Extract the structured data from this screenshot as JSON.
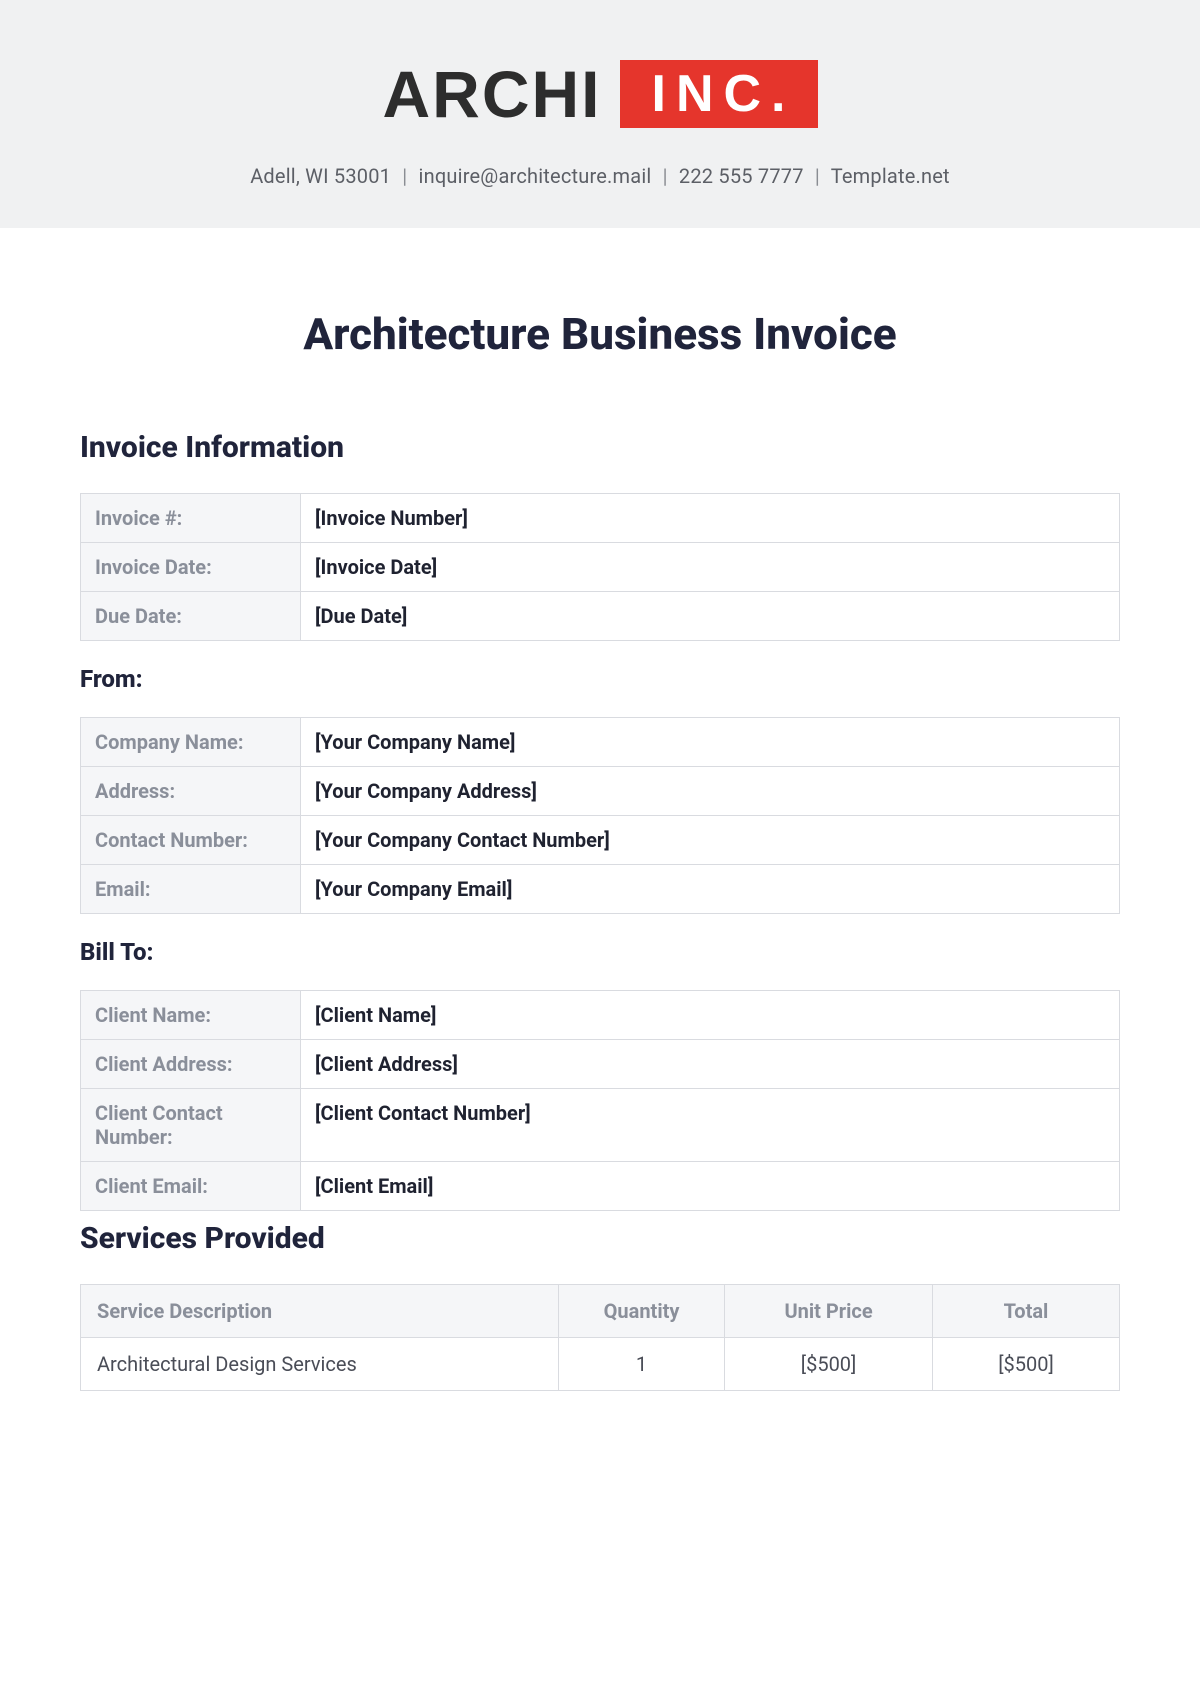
{
  "header": {
    "logo_archi": "ARCHI",
    "logo_inc": "INC.",
    "address": "Adell, WI 53001",
    "email": "inquire@architecture.mail",
    "phone": "222 555 7777",
    "site": "Template.net"
  },
  "title": "Architecture Business Invoice",
  "sections": {
    "invoice_info": "Invoice Information",
    "from": "From:",
    "bill_to": "Bill To:",
    "services": "Services Provided"
  },
  "invoice_info": {
    "rows": [
      {
        "label": "Invoice #:",
        "value": "[Invoice Number]"
      },
      {
        "label": "Invoice Date:",
        "value": "[Invoice Date]"
      },
      {
        "label": "Due Date:",
        "value": "[Due Date]"
      }
    ]
  },
  "from": {
    "rows": [
      {
        "label": "Company Name:",
        "value": "[Your Company Name]"
      },
      {
        "label": "Address:",
        "value": "[Your Company Address]"
      },
      {
        "label": "Contact Number:",
        "value": "[Your Company Contact Number]"
      },
      {
        "label": "Email:",
        "value": "[Your Company Email]"
      }
    ]
  },
  "bill_to": {
    "rows": [
      {
        "label": "Client Name:",
        "value": "[Client Name]"
      },
      {
        "label": "Client Address:",
        "value": "[Client Address]"
      },
      {
        "label": "Client Contact Number:",
        "value": "[Client Contact Number]"
      },
      {
        "label": "Client Email:",
        "value": "[Client Email]"
      }
    ]
  },
  "services_table": {
    "headers": {
      "desc": "Service Description",
      "qty": "Quantity",
      "unit": "Unit Price",
      "total": "Total"
    },
    "rows": [
      {
        "desc": "Architectural Design Services",
        "qty": "1",
        "unit": "[$500]",
        "total": "[$500]"
      }
    ]
  }
}
